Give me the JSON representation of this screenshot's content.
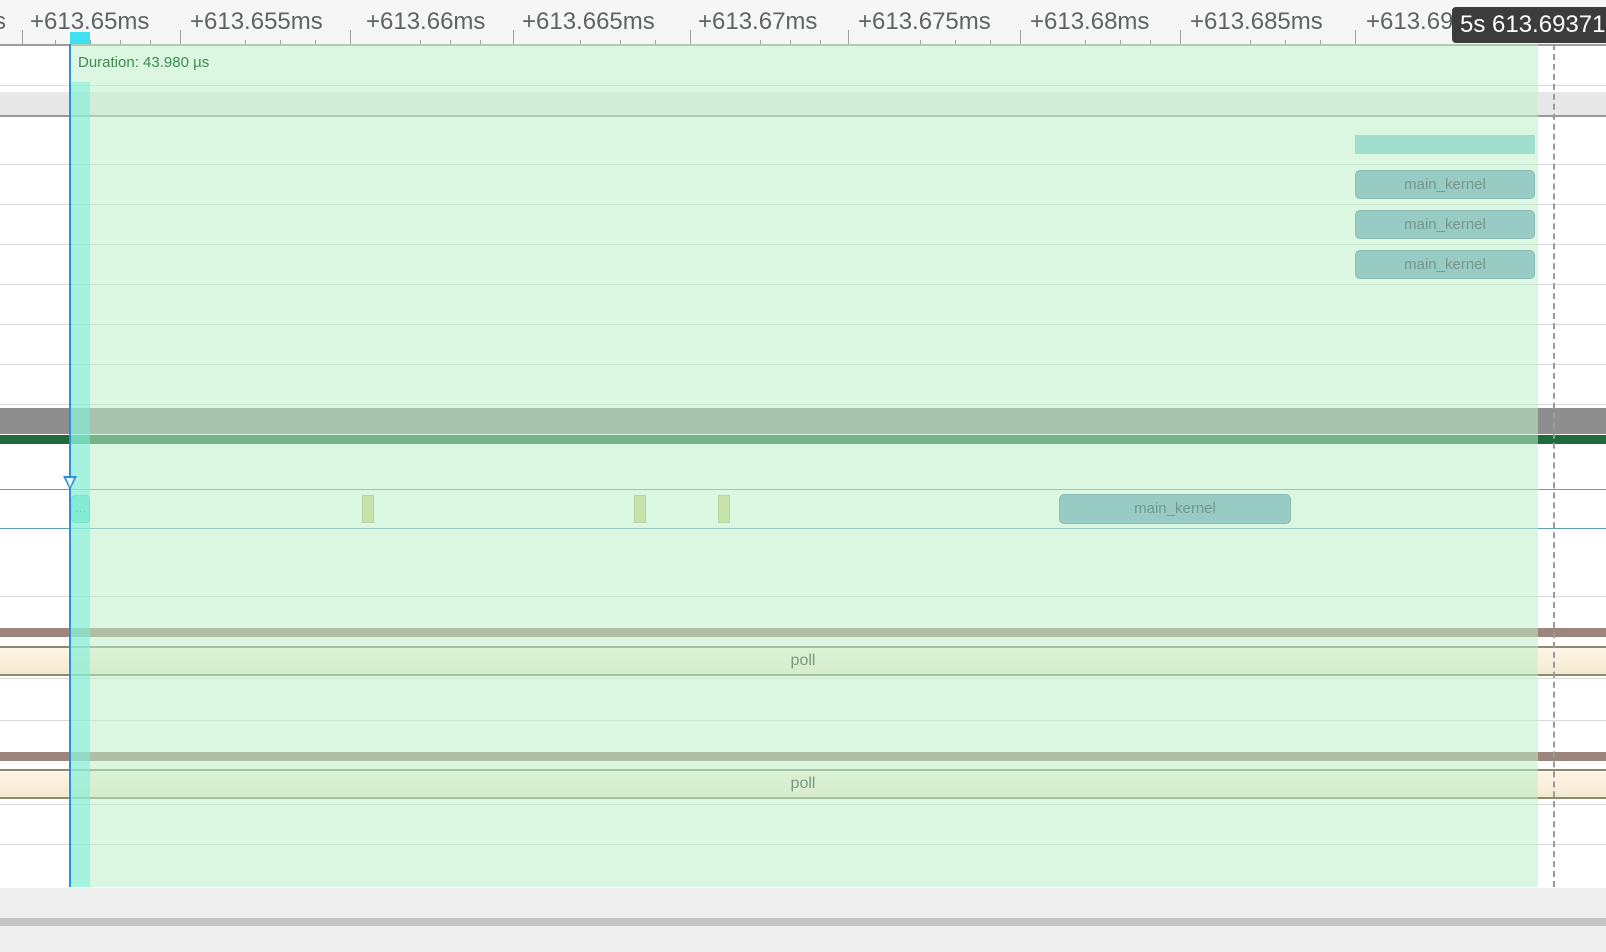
{
  "ruler": {
    "tick_labels": [
      "s",
      "+613.65ms",
      "+613.655ms",
      "+613.66ms",
      "+613.665ms",
      "+613.67ms",
      "+613.675ms",
      "+613.68ms",
      "+613.685ms",
      "+613.69"
    ],
    "cursor_time": "5s 613.69371"
  },
  "selection": {
    "duration_label": "Duration: 43.980 µs"
  },
  "gpu_tracks": {
    "slices": [
      "main_kernel",
      "main_kernel",
      "main_kernel"
    ]
  },
  "thread_track": {
    "small_slice_label": "...",
    "kernel_slice": "main_kernel"
  },
  "poll_tracks": [
    "poll",
    "poll"
  ],
  "colors": {
    "selection_area": "#d0f0d8",
    "kernel_slice": "#6c9fbf",
    "cursor_line": "#2f8fd8",
    "process_band_dark": "#1f6b3e",
    "poll_border": "#8b8a6e"
  }
}
